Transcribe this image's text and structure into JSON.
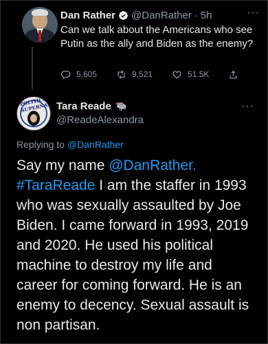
{
  "parent_tweet": {
    "name": "Dan Rather",
    "handle": "@DanRather",
    "separator": "·",
    "time": "5h",
    "more": "···",
    "text": "Can we talk about the Americans who see Putin as the ally and Biden as the enemy?",
    "replies": "5,605",
    "retweets": "9,521",
    "likes": "51.5K",
    "verified_color": "#1d9bf0"
  },
  "reply_tweet": {
    "name": "Tara Reade",
    "name_emoji": "🐃",
    "handle": "@ReadeAlexandra",
    "more": "···",
    "replying_prefix": "Replying to",
    "replying_to": "@DanRather",
    "text_lead": "Say my name",
    "mention": "@DanRather.",
    "hashtag": "#TaraReade",
    "text_body": " I am the staffer in 1993 who was sexually assaulted by Joe Biden. I came forward in 1993, 2019 and 2020. He used his political machine to destroy my life and career for coming forward. He is an enemy to decency. Sexual assault is non partisan.",
    "avatar_caption": "POLITICS SUPERNA"
  },
  "theme": {
    "background": "#000000",
    "text": "#e7e9ea",
    "secondary": "#8b98a5",
    "link": "#1d9bf0"
  }
}
